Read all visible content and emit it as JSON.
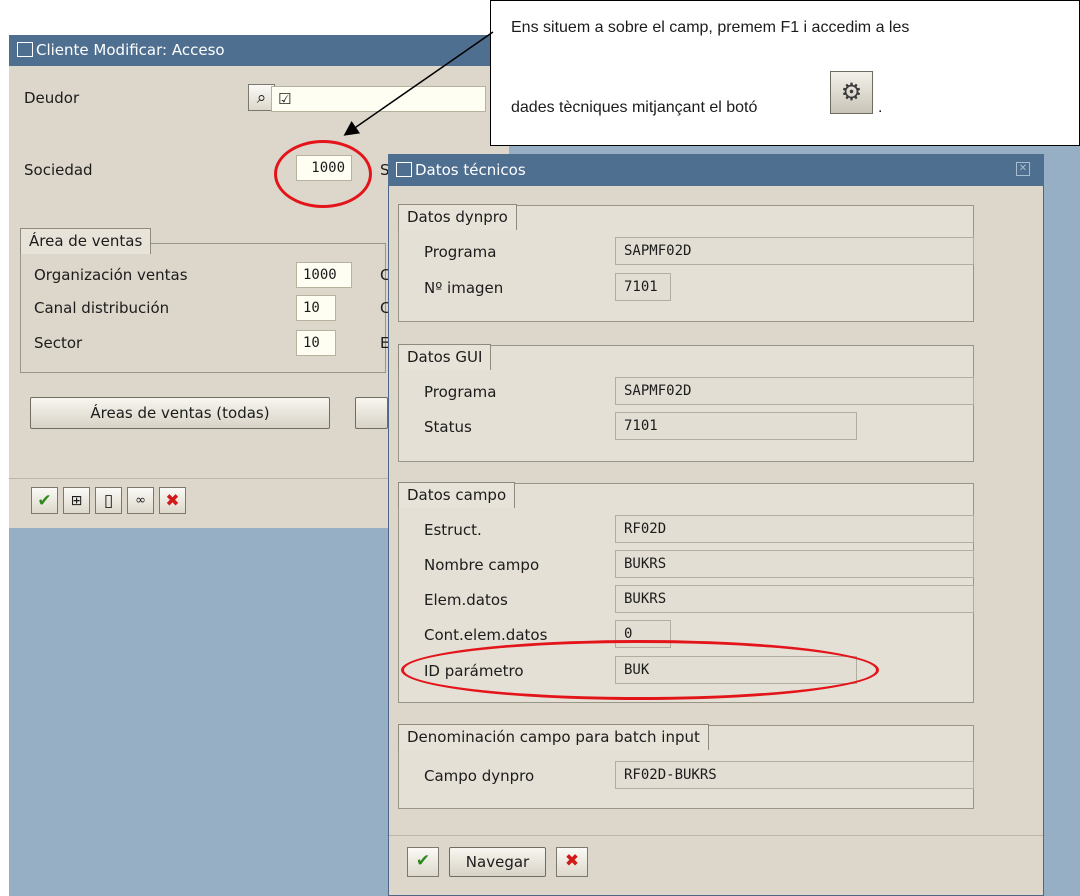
{
  "background_window": {
    "title": "Cliente Modificar: Acceso",
    "deudor_label": "Deudor",
    "deudor_value": "☑",
    "sociedad_label": "Sociedad",
    "sociedad_value": "1000",
    "sociedad_trailing": "S",
    "group_title": "Área de ventas",
    "rows": [
      {
        "label": "Organización ventas",
        "value": "1000",
        "trailing": "C"
      },
      {
        "label": "Canal distribución",
        "value": "10",
        "trailing": "C"
      },
      {
        "label": "Sector",
        "value": "10",
        "trailing": "E"
      }
    ],
    "areas_button": "Áreas de ventas (todas)"
  },
  "popup": {
    "title": "Datos técnicos",
    "sections": [
      {
        "title": "Datos dynpro",
        "rows": [
          {
            "label": "Programa",
            "value": "SAPMF02D"
          },
          {
            "label": "Nº imagen",
            "value": "7101"
          }
        ]
      },
      {
        "title": "Datos GUI",
        "rows": [
          {
            "label": "Programa",
            "value": "SAPMF02D"
          },
          {
            "label": "Status",
            "value": "7101"
          }
        ]
      },
      {
        "title": "Datos campo",
        "rows": [
          {
            "label": "Estruct.",
            "value": "RF02D"
          },
          {
            "label": "Nombre campo",
            "value": "BUKRS"
          },
          {
            "label": "Elem.datos",
            "value": "BUKRS"
          },
          {
            "label": "Cont.elem.datos",
            "value": "0"
          },
          {
            "label": "ID parámetro",
            "value": "BUK"
          }
        ]
      },
      {
        "title": "Denominación campo para batch input",
        "rows": [
          {
            "label": "Campo dynpro",
            "value": "RF02D-BUKRS"
          }
        ]
      }
    ],
    "navegar_button": "Navegar"
  },
  "callout": {
    "line1": "Ens situem a sobre el camp, premem F1 i accedim a les",
    "line2": "dades tècniques mitjançant el botó",
    "line2_end": "."
  },
  "colors": {
    "title_bar": "#4f6f91",
    "dialog_bg": "#dcd6cb",
    "desktop_bg": "#97afc4",
    "highlight_ellipse": "#e3151a"
  }
}
